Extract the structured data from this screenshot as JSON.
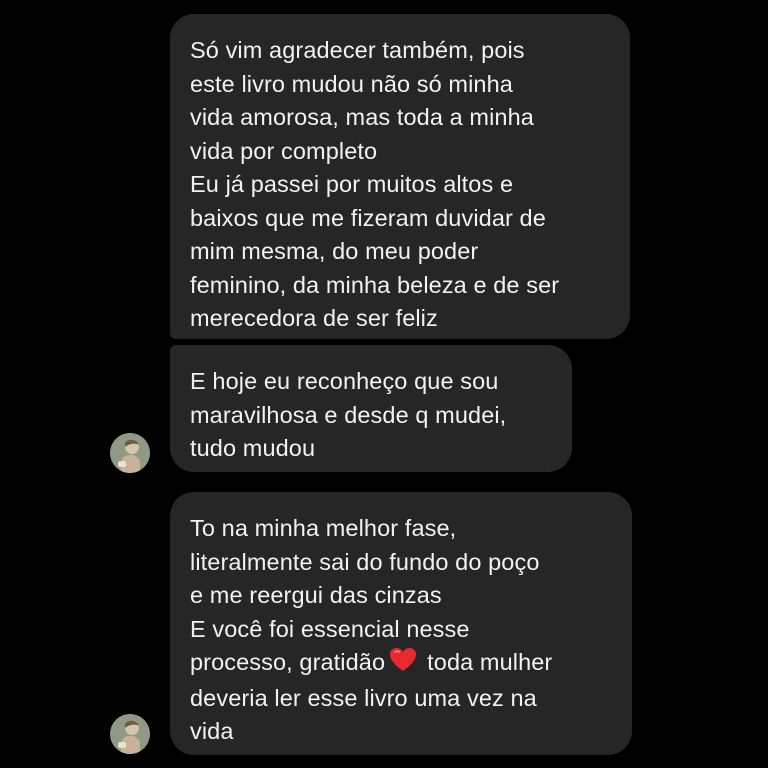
{
  "messages": [
    {
      "lines": [
        "Só vim agradecer também, pois",
        "este livro mudou não só minha",
        "vida amorosa, mas toda a minha",
        "vida por completo",
        "Eu já passei por muitos altos e",
        "baixos que me fizeram duvidar de",
        "mim mesma, do meu poder",
        "feminino, da minha beleza e de ser",
        "merecedora de ser feliz"
      ]
    },
    {
      "lines": [
        "E hoje eu reconheço que sou",
        "maravilhosa e desde q mudei,",
        "tudo mudou"
      ]
    },
    {
      "lines": [
        "To na minha melhor fase,",
        "literalmente sai do fundo do poço",
        "e me reergui das cinzas",
        "E você foi essencial nesse"
      ],
      "line_before_emoji": "processo, gratidão",
      "emoji": "red-heart-icon",
      "line_after_emoji": "toda mulher",
      "tail_lines": [
        "deveria ler esse livro uma vez na",
        "vida"
      ]
    }
  ],
  "colors": {
    "background": "#000000",
    "bubble": "#262626",
    "text": "#f2f2f2",
    "heart": "#e8292f"
  }
}
